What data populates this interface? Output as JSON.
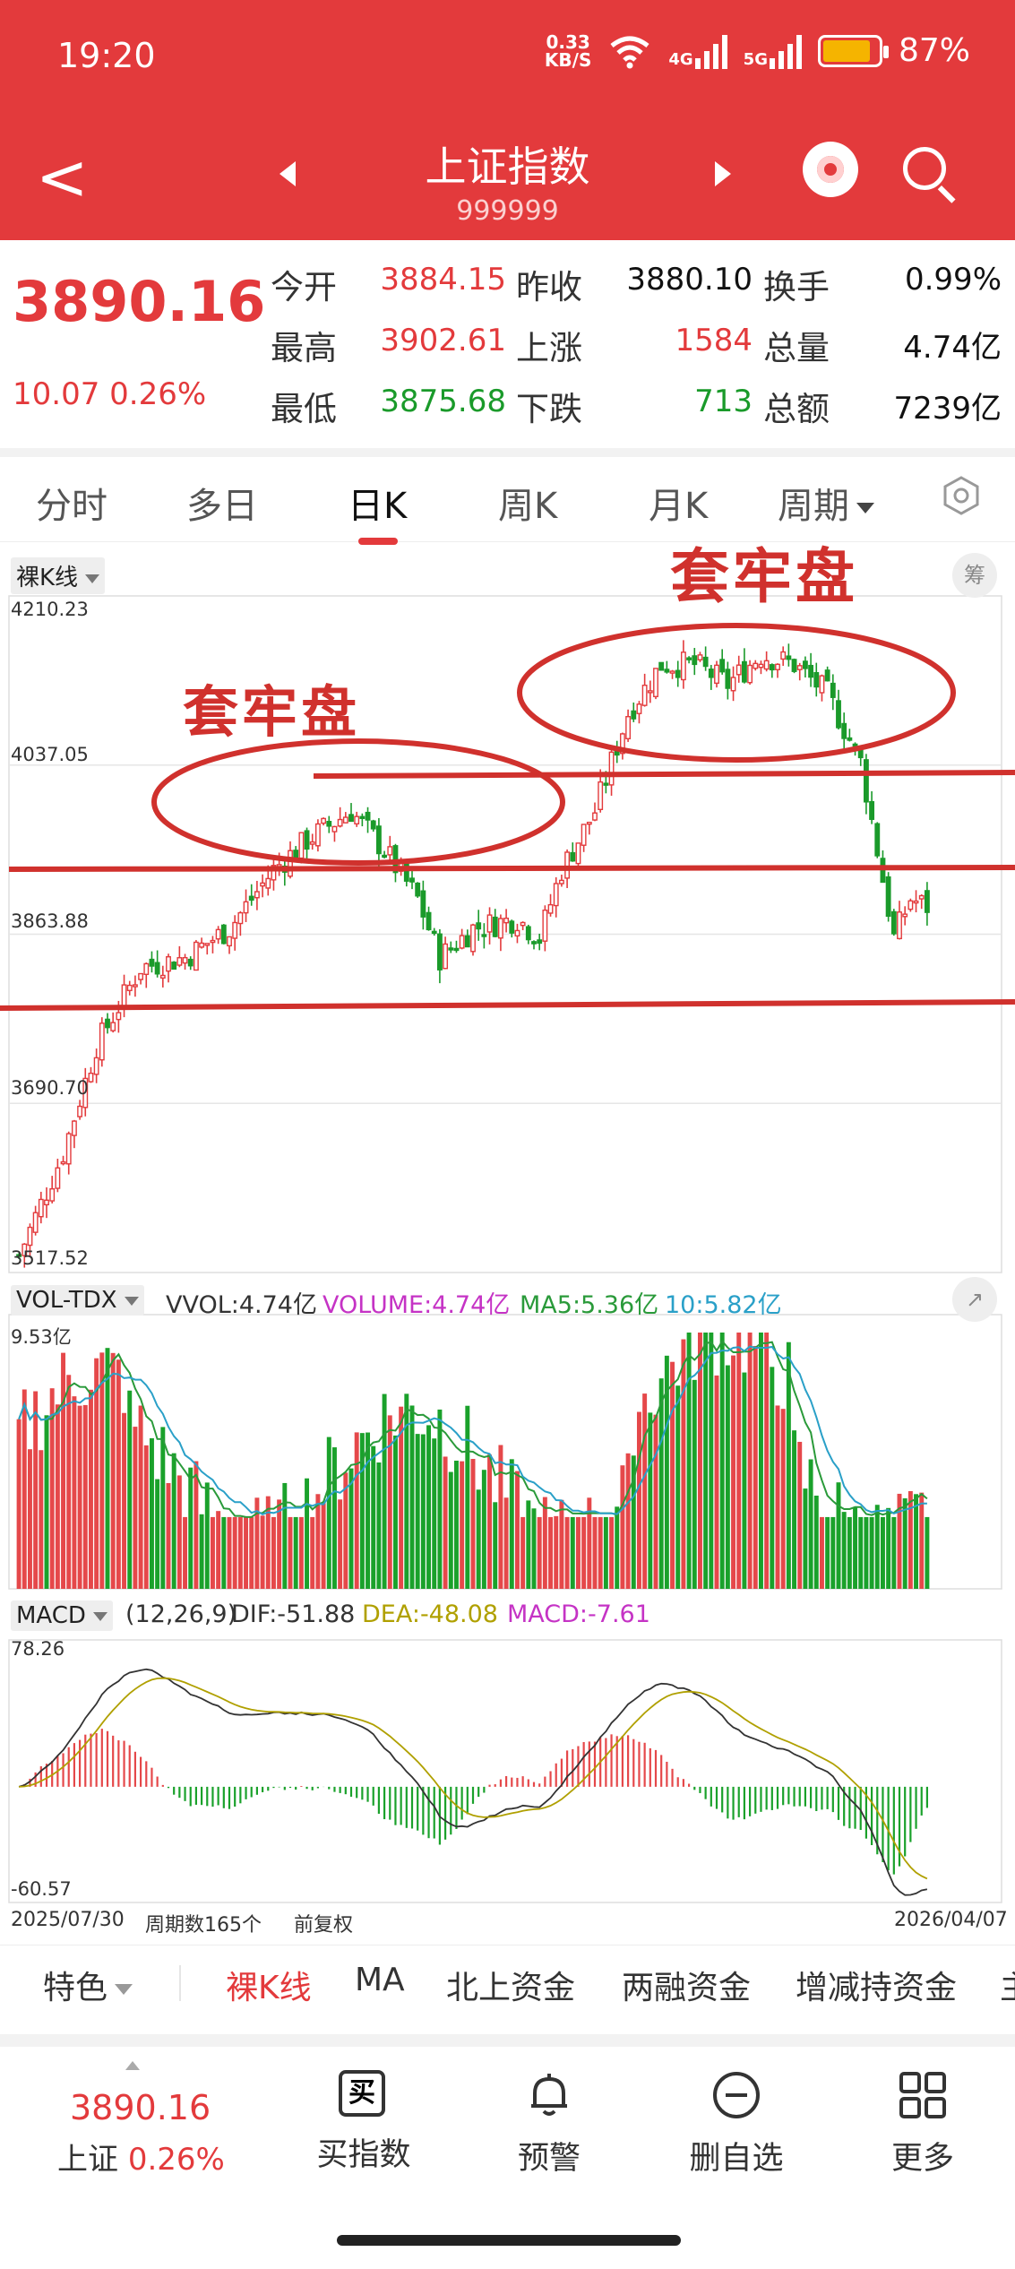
{
  "status_bar": {
    "time": "19:20",
    "net_speed": "0.33",
    "net_unit": "KB/S",
    "signal1": "4G",
    "signal2": "5G",
    "battery": "87%"
  },
  "header": {
    "title": "上证指数",
    "code": "999999"
  },
  "quote": {
    "price": "3890.16",
    "change": "10.07",
    "change_pct": "0.26%",
    "rows": [
      [
        {
          "l": "今开",
          "v": "3884.15",
          "c": "red"
        },
        {
          "l": "昨收",
          "v": "3880.10",
          "c": "black"
        },
        {
          "l": "换手",
          "v": "0.99%",
          "c": "black"
        }
      ],
      [
        {
          "l": "最高",
          "v": "3902.61",
          "c": "red"
        },
        {
          "l": "上涨",
          "v": "1584",
          "c": "red"
        },
        {
          "l": "总量",
          "v": "4.74亿",
          "c": "black"
        }
      ],
      [
        {
          "l": "最低",
          "v": "3875.68",
          "c": "green"
        },
        {
          "l": "下跌",
          "v": "713",
          "c": "green"
        },
        {
          "l": "总额",
          "v": "7239亿",
          "c": "black"
        }
      ]
    ]
  },
  "tabs": [
    "分时",
    "多日",
    "日K",
    "周K",
    "月K",
    "周期"
  ],
  "kline": {
    "mode_chip": "裸K线",
    "right_chip": "筹",
    "y_ticks": [
      "4210.23",
      "4037.05",
      "3863.88",
      "3690.70",
      "3517.52"
    ],
    "annotation": "套牢盘",
    "annotation2": "套牢盘",
    "colors": {
      "up": "#e33a3c",
      "down": "#1a9a2a",
      "mark": "#d0312d"
    }
  },
  "volume": {
    "chip": "VOL-TDX",
    "vvol": "VVOL:4.74亿",
    "volume": "VOLUME:4.74亿",
    "ma5": "MA5:5.36亿",
    "ma10": "10:5.82亿",
    "max_label": "9.53亿"
  },
  "macd": {
    "chip": "MACD",
    "params": "(12,26,9)",
    "dif": "DIF:-51.88",
    "dea": "DEA:-48.08",
    "macd": "MACD:-7.61",
    "top": "78.26",
    "bottom": "-60.57"
  },
  "footer": {
    "start": "2025/07/30",
    "count": "周期数165个",
    "adjust": "前复权",
    "end": "2026/04/07"
  },
  "feature_tabs": [
    "特色",
    "裸K线",
    "MA",
    "北上资金",
    "两融资金",
    "增减持资金",
    "主"
  ],
  "bottom": {
    "price": "3890.16",
    "name": "上证",
    "pct": "0.26%",
    "actions": [
      "买指数",
      "预警",
      "删自选",
      "更多"
    ],
    "buy_glyph": "买"
  },
  "chart_data": {
    "type": "candlestick",
    "y_range": [
      3517.52,
      4210.23
    ],
    "x_range": [
      "2025/07/30",
      "2026/04/07"
    ],
    "periods": 165,
    "latest": {
      "open": 3884.15,
      "high": 3902.61,
      "low": 3875.68,
      "close": 3890.16,
      "prev_close": 3880.1
    },
    "macd_range": [
      -60.57,
      78.26
    ],
    "volume_max": "9.53亿"
  }
}
